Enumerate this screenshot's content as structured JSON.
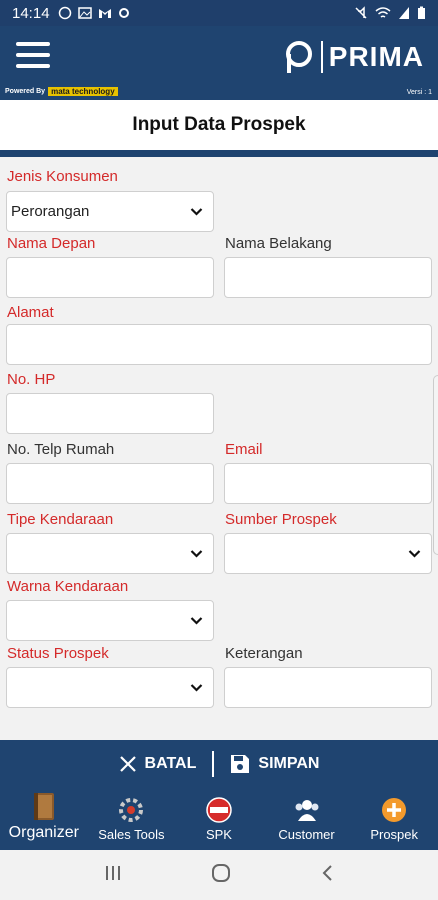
{
  "status_bar": {
    "time": "14:14",
    "icons": [
      "whatsapp-icon",
      "image-icon",
      "gmail-icon",
      "sync-icon"
    ],
    "right_icons": [
      "mute-icon",
      "wifi-icon",
      "signal-icon",
      "battery-icon"
    ]
  },
  "app_bar": {
    "brand": "PRIMA",
    "powered_by": "Powered By",
    "powered_logo": "mata technology",
    "version": "Versi : 1"
  },
  "page": {
    "title": "Input Data Prospek"
  },
  "form": {
    "jenis_konsumen": {
      "label": "Jenis Konsumen",
      "value": "Perorangan"
    },
    "nama_depan": {
      "label": "Nama Depan",
      "value": ""
    },
    "nama_belakang": {
      "label": "Nama Belakang",
      "value": ""
    },
    "alamat": {
      "label": "Alamat",
      "value": ""
    },
    "no_hp": {
      "label": "No. HP",
      "value": ""
    },
    "no_telp_rumah": {
      "label": "No. Telp Rumah",
      "value": ""
    },
    "email": {
      "label": "Email",
      "value": ""
    },
    "tipe_kendaraan": {
      "label": "Tipe Kendaraan",
      "value": ""
    },
    "sumber_prospek": {
      "label": "Sumber Prospek",
      "value": ""
    },
    "warna_kendaraan": {
      "label": "Warna Kendaraan",
      "value": ""
    },
    "status_prospek": {
      "label": "Status Prospek",
      "value": ""
    },
    "keterangan": {
      "label": "Keterangan",
      "value": ""
    }
  },
  "actions": {
    "cancel": "BATAL",
    "save": "SIMPAN"
  },
  "bottom_nav": [
    {
      "label": "Organizer",
      "icon": "book-icon"
    },
    {
      "label": "Sales Tools",
      "icon": "tools-icon"
    },
    {
      "label": "SPK",
      "icon": "spk-badge-icon"
    },
    {
      "label": "Customer",
      "icon": "people-icon"
    },
    {
      "label": "Prospek",
      "icon": "add-circle-icon"
    }
  ],
  "colors": {
    "primary": "#1f4470",
    "required_label": "#d42a2a",
    "background": "#f2f2f2"
  }
}
